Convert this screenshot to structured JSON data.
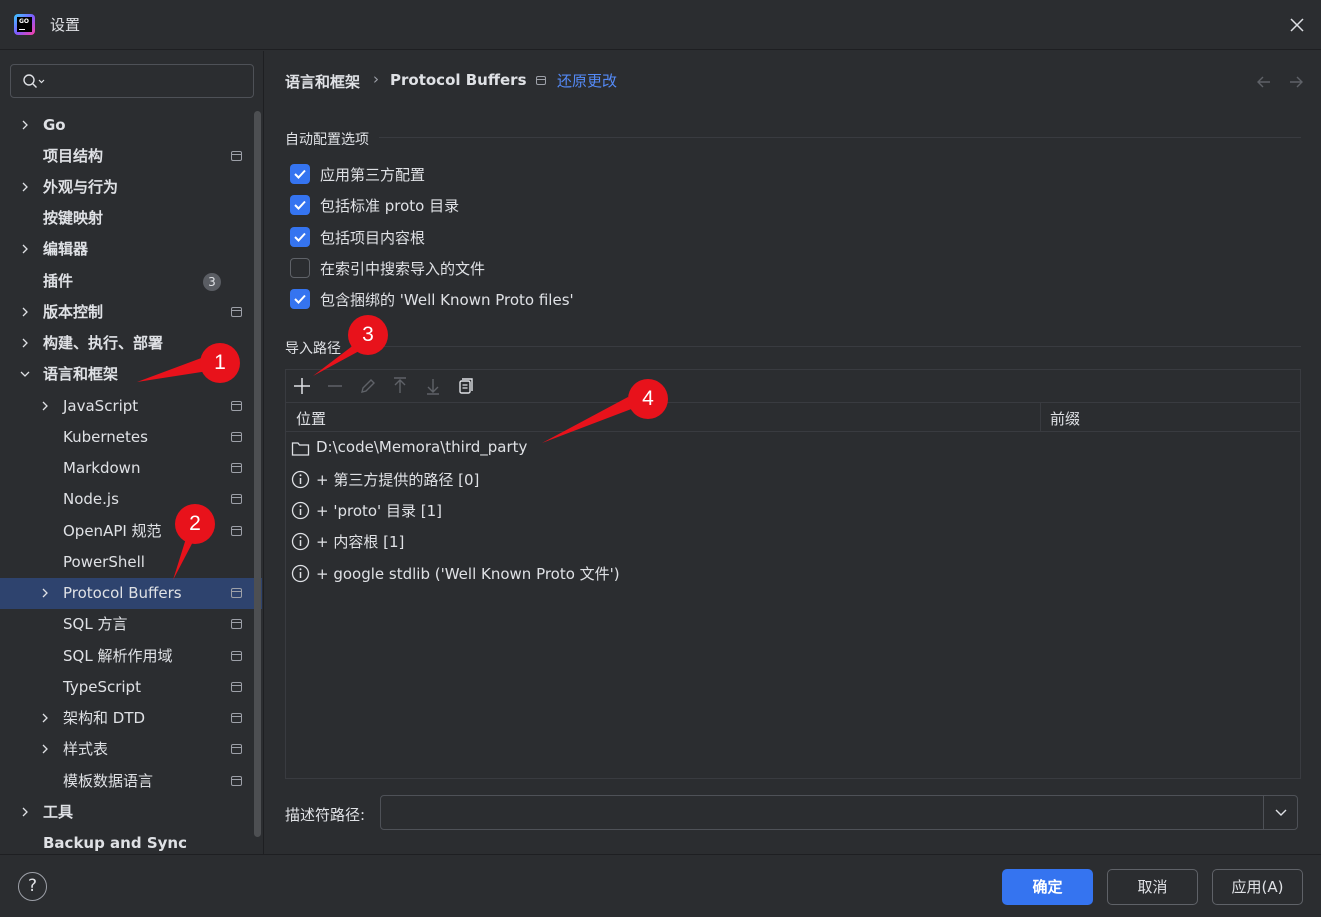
{
  "window": {
    "title": "设置",
    "app_icon_text": "GO"
  },
  "search": {
    "placeholder": ""
  },
  "sidebar": {
    "items": [
      {
        "label": "Go"
      },
      {
        "label": "项目结构"
      },
      {
        "label": "外观与行为"
      },
      {
        "label": "按键映射"
      },
      {
        "label": "编辑器"
      },
      {
        "label": "插件",
        "badge": "3"
      },
      {
        "label": "版本控制"
      },
      {
        "label": "构建、执行、部署"
      },
      {
        "label": "语言和框架"
      },
      {
        "label": "JavaScript"
      },
      {
        "label": "Kubernetes"
      },
      {
        "label": "Markdown"
      },
      {
        "label": "Node.js"
      },
      {
        "label": "OpenAPI 规范"
      },
      {
        "label": "PowerShell"
      },
      {
        "label": "Protocol Buffers"
      },
      {
        "label": "SQL 方言"
      },
      {
        "label": "SQL 解析作用域"
      },
      {
        "label": "TypeScript"
      },
      {
        "label": "架构和 DTD"
      },
      {
        "label": "样式表"
      },
      {
        "label": "模板数据语言"
      },
      {
        "label": "工具"
      },
      {
        "label": "Backup and Sync"
      }
    ]
  },
  "breadcrumb": {
    "parent": "语言和框架",
    "separator": "›",
    "current": "Protocol Buffers",
    "revert_label": "还原更改"
  },
  "auto_config": {
    "title": "自动配置选项",
    "options": [
      {
        "label": "应用第三方配置",
        "checked": true
      },
      {
        "label": "包括标准 proto 目录",
        "checked": true
      },
      {
        "label": "包括项目内容根",
        "checked": true
      },
      {
        "label": "在索引中搜索导入的文件",
        "checked": false
      },
      {
        "label": "包含捆绑的 'Well Known Proto files'",
        "checked": true
      }
    ]
  },
  "import_paths": {
    "title": "导入路径",
    "columns": {
      "location": "位置",
      "prefix": "前缀"
    },
    "rows": [
      {
        "icon": "folder-icon",
        "text": "D:\\code\\Memora\\third_party"
      },
      {
        "icon": "info-icon",
        "text": "+ 第三方提供的路径 [0]"
      },
      {
        "icon": "info-icon",
        "text": "+ 'proto' 目录 [1]"
      },
      {
        "icon": "info-icon",
        "text": "+ 内容根 [1]"
      },
      {
        "icon": "info-icon",
        "text": "+ google stdlib ('Well Known Proto 文件')"
      }
    ]
  },
  "descriptor": {
    "label": "描述符路径:",
    "value": ""
  },
  "footer": {
    "help": "?",
    "ok": "确定",
    "cancel": "取消",
    "apply": "应用(A)"
  },
  "annotations": [
    "1",
    "2",
    "3",
    "4"
  ],
  "colors": {
    "accent": "#3574f0",
    "link": "#548af7",
    "selected": "#2e436e",
    "annotation": "#e8121b"
  }
}
